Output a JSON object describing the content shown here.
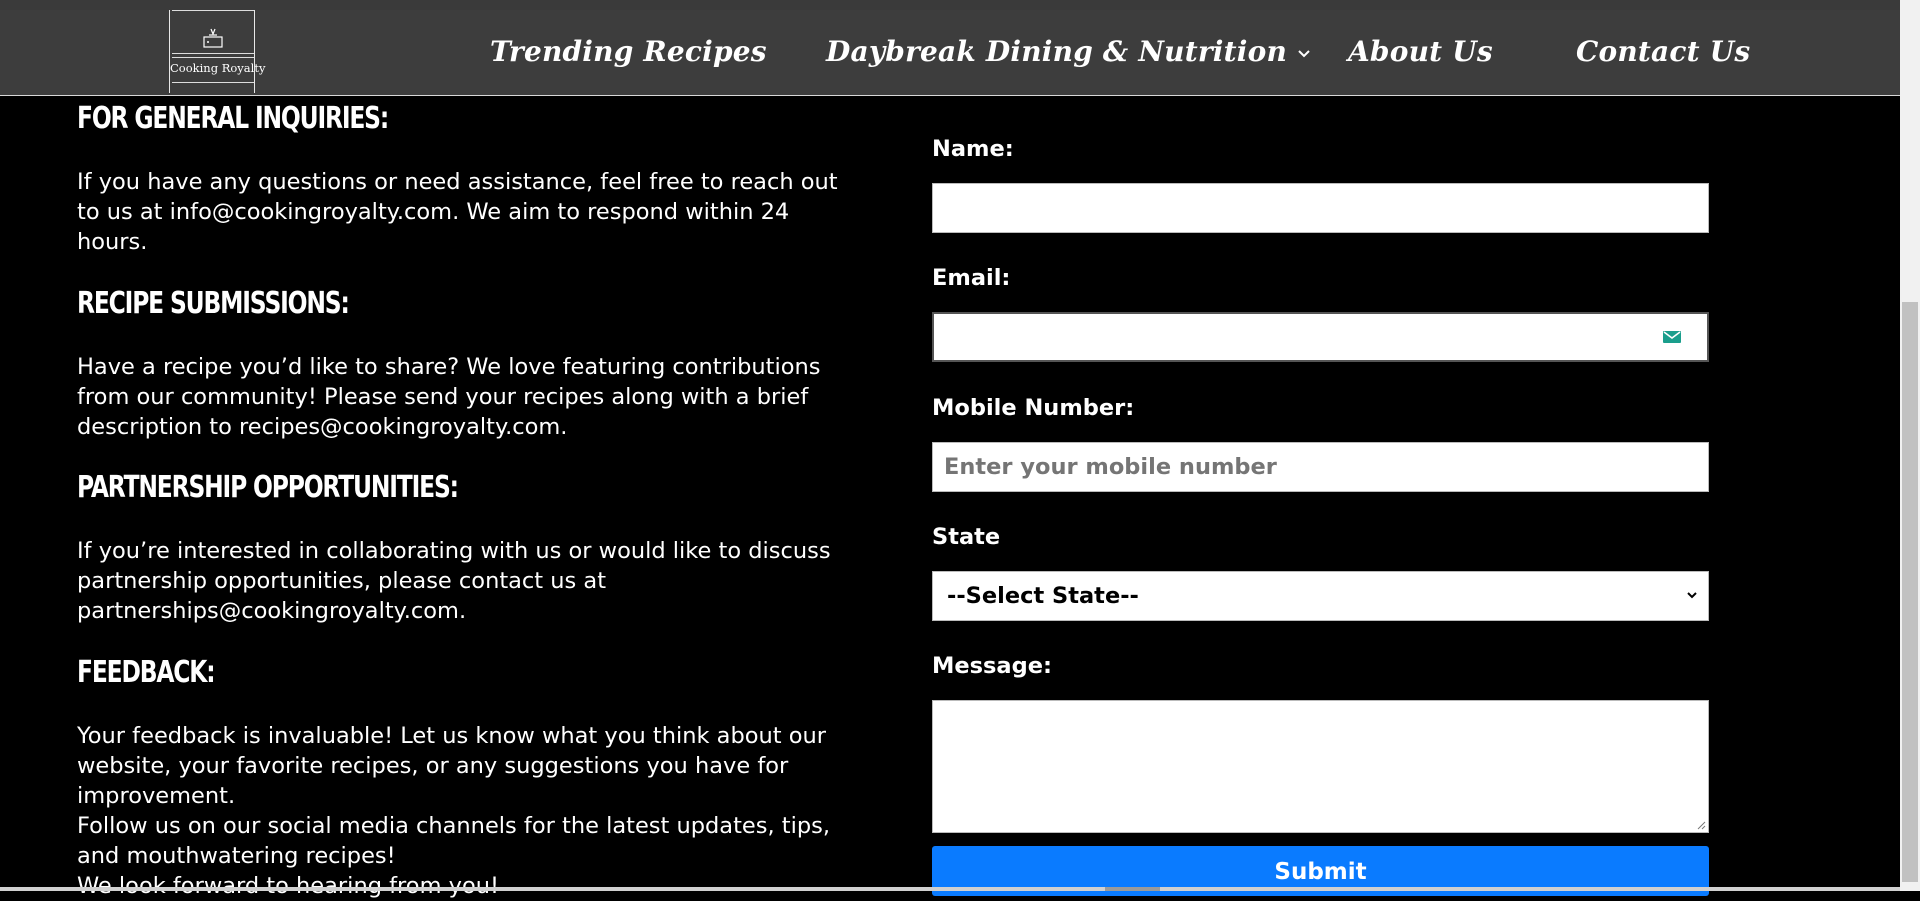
{
  "header": {
    "logo_text": "Cooking Royalty",
    "nav": [
      {
        "label": "Trending Recipes"
      },
      {
        "label": "Daybreak Dining & Nutrition"
      },
      {
        "label": "About Us"
      },
      {
        "label": "Contact Us"
      }
    ]
  },
  "info": {
    "sections": [
      {
        "heading": "FOR GENERAL INQUIRIES:",
        "text": "If you have any questions or need assistance, feel free to reach out to us at info@cookingroyalty.com. We aim to respond within 24 hours."
      },
      {
        "heading": "RECIPE SUBMISSIONS:",
        "text": "Have a recipe you’d like to share? We love featuring contributions from our community! Please send your recipes along with a brief description to recipes@cookingroyalty.com."
      },
      {
        "heading": "PARTNERSHIP OPPORTUNITIES:",
        "text": "If you’re interested in collaborating with us or would like to discuss partnership opportunities, please contact us at partnerships@cookingroyalty.com."
      },
      {
        "heading": "FEEDBACK:",
        "text": "Your feedback is invaluable! Let us know what you think about our website, your favorite recipes, or any suggestions you have for improvement."
      }
    ],
    "follow_text": "Follow us on our social media channels for the latest updates, tips, and mouthwatering recipes!",
    "closing_text": "We look forward to hearing from you!"
  },
  "form": {
    "name_label": "Name:",
    "email_label": "Email:",
    "mobile_label": "Mobile Number:",
    "mobile_placeholder": "Enter your mobile number",
    "state_label": "State",
    "state_selected": "--Select State--",
    "message_label": "Message:",
    "submit_label": "Submit"
  },
  "colors": {
    "page_bg": "#000000",
    "header_bg": "#3d3d3d",
    "submit_bg": "#0a7bff",
    "email_icon": "#1a9e8c"
  },
  "icons": {
    "nav_caret": "chevron-down-icon",
    "email_field": "envelope-icon",
    "select_caret": "chevron-down-icon"
  }
}
